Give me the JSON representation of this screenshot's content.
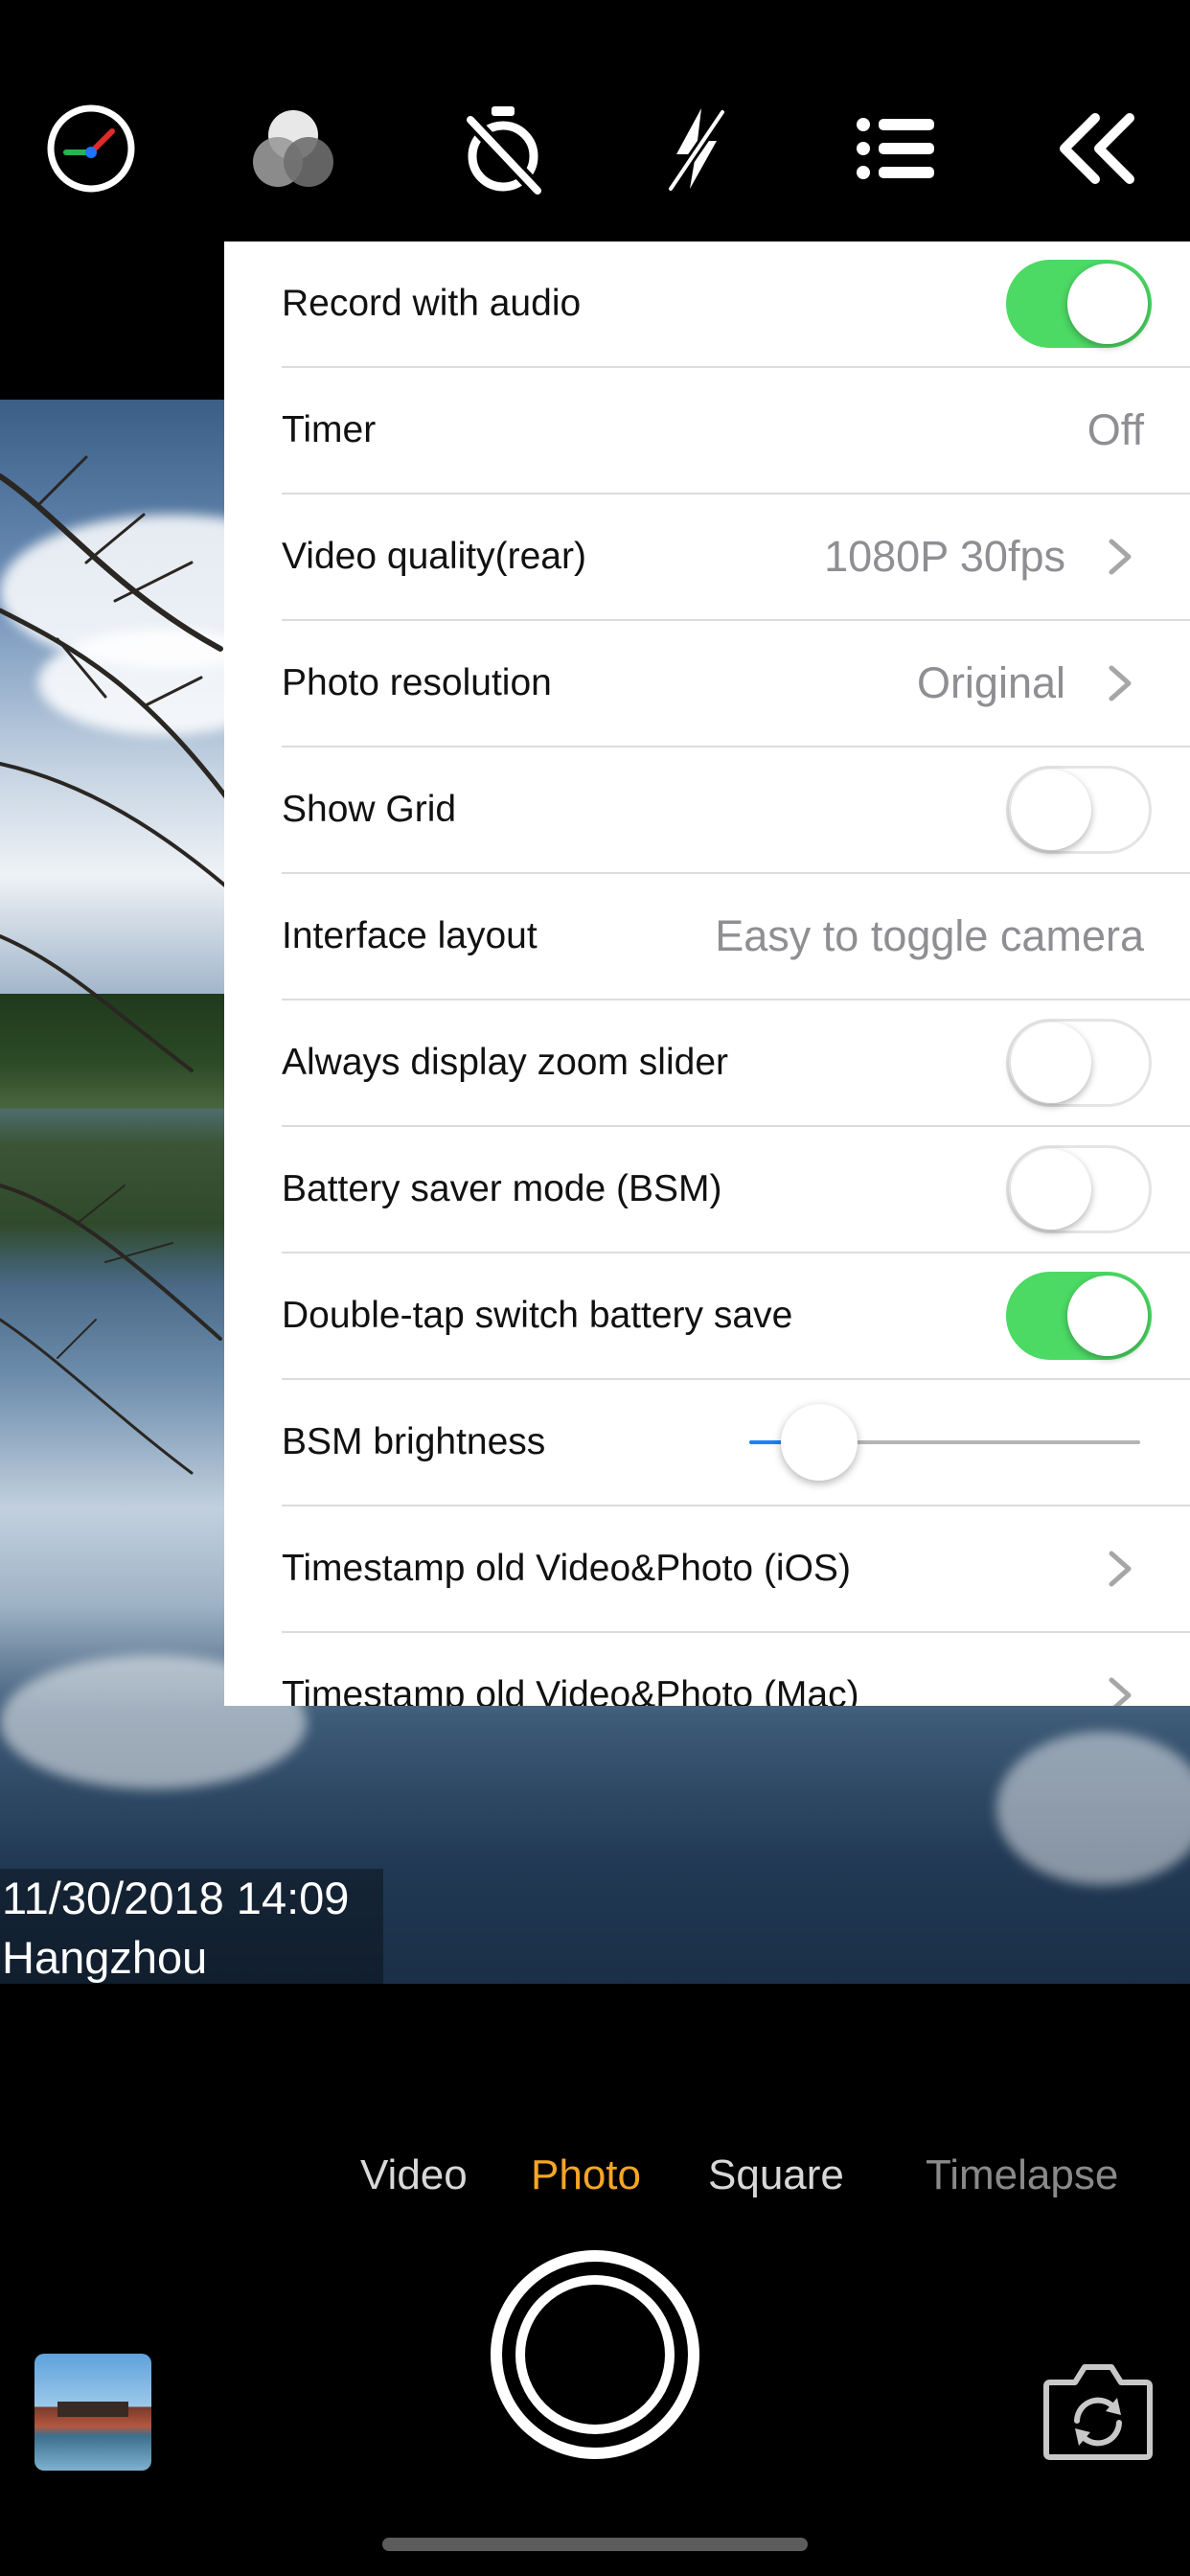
{
  "toolbar": {
    "icons": [
      "speedometer-icon",
      "color-filter-icon",
      "timer-off-icon",
      "flash-off-icon",
      "list-menu-icon",
      "collapse-icon"
    ]
  },
  "settings": {
    "record_audio": {
      "label": "Record with audio",
      "enabled": true
    },
    "timer": {
      "label": "Timer",
      "value": "Off"
    },
    "video_quality": {
      "label": "Video quality(rear)",
      "value": "1080P 30fps"
    },
    "photo_resolution": {
      "label": "Photo resolution",
      "value": "Original"
    },
    "show_grid": {
      "label": "Show Grid",
      "enabled": false
    },
    "interface_layout": {
      "label": "Interface layout",
      "value": "Easy to toggle camera"
    },
    "zoom_slider": {
      "label": "Always display zoom slider",
      "enabled": false
    },
    "battery_saver": {
      "label": "Battery saver mode (BSM)",
      "enabled": false
    },
    "double_tap": {
      "label": "Double-tap switch battery save",
      "enabled": true
    },
    "bsm_brightness": {
      "label": "BSM brightness",
      "level_percent": 10
    },
    "timestamp_ios": {
      "label": "Timestamp old Video&Photo (iOS)"
    },
    "timestamp_mac": {
      "label": "Timestamp old Video&Photo (Mac)"
    }
  },
  "viewfinder": {
    "timestamp_date": "11/30/2018 14:09",
    "timestamp_location": "Hangzhou"
  },
  "modes": {
    "video": "Video",
    "photo": "Photo",
    "square": "Square",
    "timelapse": "Timelapse",
    "active": "Photo"
  },
  "colors": {
    "accent_orange": "#f5a623",
    "switch_on": "#4cd964",
    "slider_fill": "#1a82fb"
  }
}
